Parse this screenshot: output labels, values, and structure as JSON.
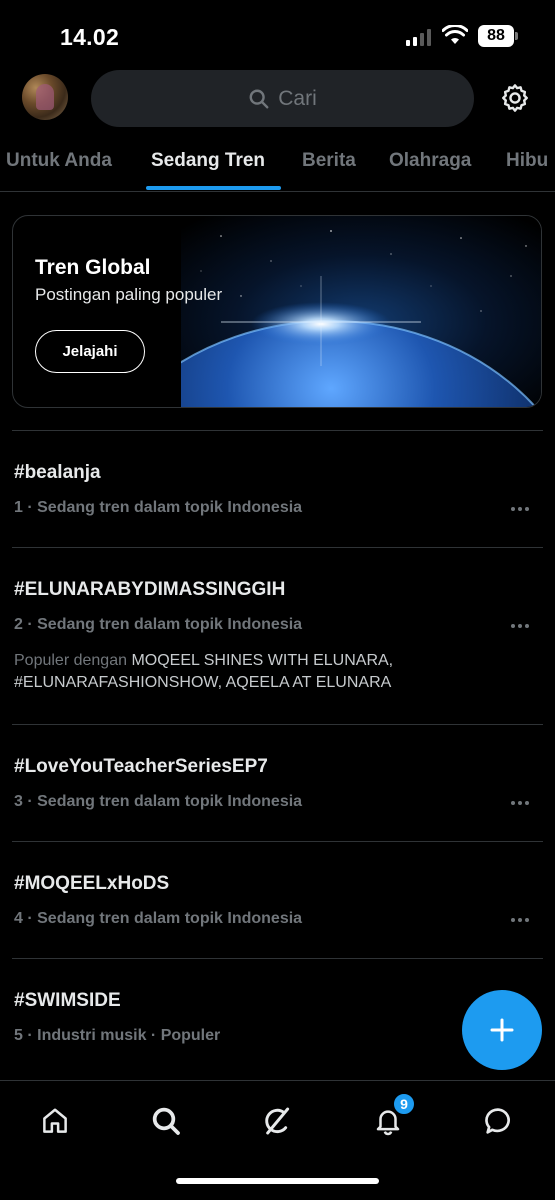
{
  "status_bar": {
    "time": "14.02",
    "battery": "88"
  },
  "header": {
    "search_placeholder": "Cari"
  },
  "tabs": [
    {
      "label": "Untuk Anda"
    },
    {
      "label": "Sedang Tren"
    },
    {
      "label": "Berita"
    },
    {
      "label": "Olahraga"
    },
    {
      "label": "Hibu"
    }
  ],
  "active_tab": "Sedang Tren",
  "global_card": {
    "title": "Tren Global",
    "subtitle": "Postingan paling populer",
    "button": "Jelajahi"
  },
  "trends": [
    {
      "name": "#bealanja",
      "meta": "1 · Sedang tren dalam topik Indonesia"
    },
    {
      "name": "#ELUNARABYDIMASSINGGIH",
      "meta": "2 · Sedang tren dalam topik Indonesia",
      "extra_prefix": "Populer dengan",
      "extra_line1": "MOQEEL SHINES WITH ELUNARA,",
      "extra_line2": "#ELUNARAFASHIONSHOW, AQEELA AT ELUNARA"
    },
    {
      "name": "#LoveYouTeacherSeriesEP7",
      "meta": "3 · Sedang tren dalam topik Indonesia"
    },
    {
      "name": "#MOQEELxHoDS",
      "meta": "4 · Sedang tren dalam topik Indonesia"
    },
    {
      "name": "#SWIMSIDE",
      "meta": "5 · Industri musik · Populer"
    }
  ],
  "bottom_nav": {
    "items": [
      "home-icon",
      "search-icon",
      "grok-icon",
      "bell-icon",
      "messages-icon"
    ],
    "notification_count": "9"
  },
  "colors": {
    "accent": "#1d9bf0",
    "background": "#000000",
    "muted_text": "#71767b"
  }
}
